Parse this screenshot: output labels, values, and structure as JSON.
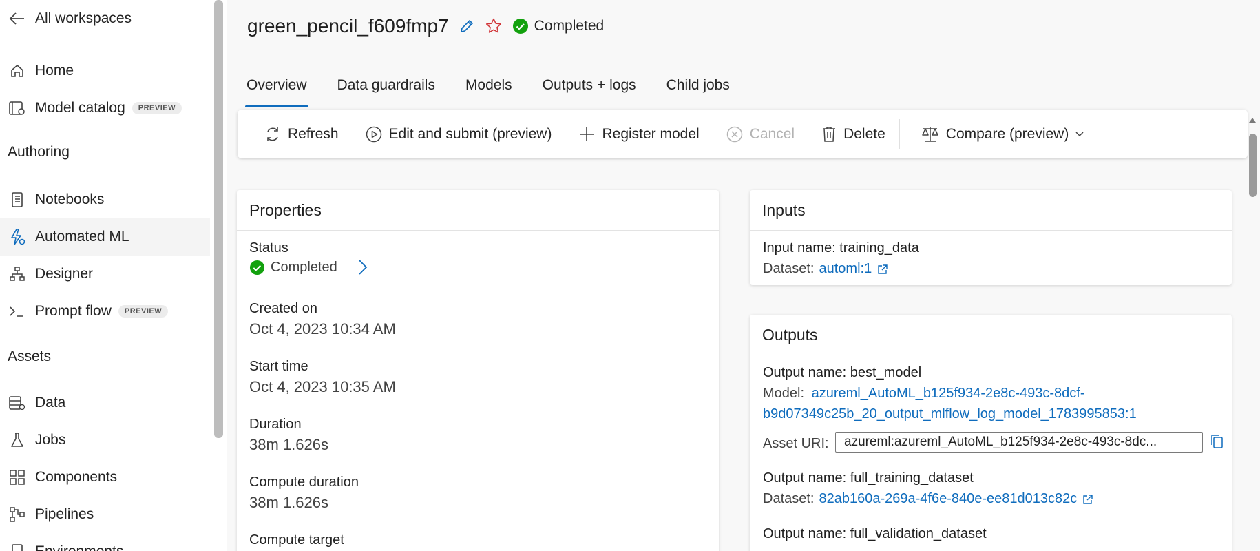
{
  "sidebar": {
    "back_label": "All workspaces",
    "items_top": [
      {
        "label": "Home",
        "icon": "home-icon"
      },
      {
        "label": "Model catalog",
        "icon": "model-catalog-icon",
        "badge": "PREVIEW"
      }
    ],
    "section_authoring": "Authoring",
    "items_authoring": [
      {
        "label": "Notebooks",
        "icon": "notebook-icon"
      },
      {
        "label": "Automated ML",
        "icon": "automl-icon"
      },
      {
        "label": "Designer",
        "icon": "designer-icon"
      },
      {
        "label": "Prompt flow",
        "icon": "prompt-flow-icon",
        "badge": "PREVIEW"
      }
    ],
    "section_assets": "Assets",
    "items_assets": [
      {
        "label": "Data",
        "icon": "data-icon"
      },
      {
        "label": "Jobs",
        "icon": "flask-icon"
      },
      {
        "label": "Components",
        "icon": "components-icon"
      },
      {
        "label": "Pipelines",
        "icon": "pipelines-icon"
      },
      {
        "label": "Environments",
        "icon": "environments-icon"
      }
    ]
  },
  "header": {
    "title": "green_pencil_f609fmp7",
    "status": "Completed"
  },
  "tabs": [
    "Overview",
    "Data guardrails",
    "Models",
    "Outputs + logs",
    "Child jobs"
  ],
  "toolbar": {
    "refresh": "Refresh",
    "edit_submit": "Edit and submit (preview)",
    "register_model": "Register model",
    "cancel": "Cancel",
    "delete": "Delete",
    "compare": "Compare (preview)"
  },
  "properties": {
    "title": "Properties",
    "status_label": "Status",
    "status_value": "Completed",
    "created_label": "Created on",
    "created_value": "Oct 4, 2023 10:34 AM",
    "start_label": "Start time",
    "start_value": "Oct 4, 2023 10:35 AM",
    "duration_label": "Duration",
    "duration_value": "38m 1.626s",
    "compute_duration_label": "Compute duration",
    "compute_duration_value": "38m 1.626s",
    "compute_target_label": "Compute target"
  },
  "inputs": {
    "title": "Inputs",
    "input_name": "Input name: training_data",
    "dataset_prefix": "Dataset:",
    "dataset_link": "automl:1"
  },
  "outputs": {
    "title": "Outputs",
    "out1_name": "Output name: best_model",
    "model_prefix": "Model:",
    "model_link_line1": "azureml_AutoML_b125f934-2e8c-493c-8dcf-",
    "model_link_line2": "b9d07349c25b_20_output_mlflow_log_model_1783995853:1",
    "asset_uri_label": "Asset URI:",
    "asset_uri_value": "azureml:azureml_AutoML_b125f934-2e8c-493c-8dc...",
    "out2_name": "Output name: full_training_dataset",
    "dataset_prefix": "Dataset:",
    "dataset2_link": "82ab160a-269a-4f6e-840e-ee81d013c82c",
    "out3_name": "Output name: full_validation_dataset"
  },
  "colors": {
    "accent": "#0f6cbd",
    "success": "#13a10e",
    "star": "#d13438"
  }
}
